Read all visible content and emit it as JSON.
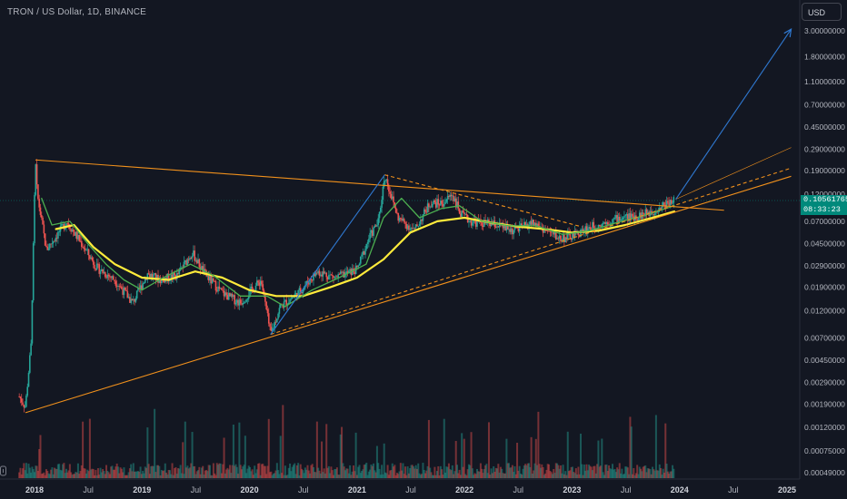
{
  "header": {
    "symbol_line": "TRON / US Dollar, 1D, BINANCE"
  },
  "toolbar": {
    "currency_label": "USD"
  },
  "price_label": {
    "price": "0.10561765",
    "countdown": "08:33:23",
    "color": "#00897b"
  },
  "colors": {
    "background": "#131722",
    "bull_candle": "#26a69a",
    "bear_candle": "#ef5350",
    "ma_yellow": "#ffeb3b",
    "ma_green": "#4caf50",
    "trendline_orange": "#f0901c",
    "arrow_blue": "#2f78d0"
  },
  "icons": {
    "settings": "gear-icon"
  },
  "chart_data": {
    "type": "candlestick",
    "title": "TRON / US Dollar, 1D, BINANCE",
    "yscale": "log",
    "y_ticks": [
      "3.00000000",
      "1.80000000",
      "1.10000000",
      "0.70000000",
      "0.45000000",
      "0.29000000",
      "0.19000000",
      "0.12000000",
      "0.07000000",
      "0.04500000",
      "0.02900000",
      "0.01900000",
      "0.01200000",
      "0.00700000",
      "0.00450000",
      "0.00290000",
      "0.00190000",
      "0.00120000",
      "0.00075000",
      "0.00049000"
    ],
    "x_ticks": [
      "2018",
      "Jul",
      "2019",
      "Jul",
      "2020",
      "Jul",
      "2021",
      "Jul",
      "2022",
      "Jul",
      "2023",
      "Jul",
      "2024",
      "Jul",
      "2025"
    ],
    "price_path": [
      [
        "2017-11-10",
        0.0022
      ],
      [
        "2017-12-01",
        0.0018
      ],
      [
        "2017-12-20",
        0.006
      ],
      [
        "2018-01-04",
        0.23
      ],
      [
        "2018-01-10",
        0.12
      ],
      [
        "2018-02-10",
        0.04
      ],
      [
        "2018-03-10",
        0.05
      ],
      [
        "2018-04-20",
        0.07
      ],
      [
        "2018-06-10",
        0.045
      ],
      [
        "2018-08-01",
        0.028
      ],
      [
        "2018-10-01",
        0.022
      ],
      [
        "2018-12-01",
        0.014
      ],
      [
        "2019-01-20",
        0.025
      ],
      [
        "2019-03-01",
        0.022
      ],
      [
        "2019-05-01",
        0.024
      ],
      [
        "2019-06-20",
        0.038
      ],
      [
        "2019-08-01",
        0.025
      ],
      [
        "2019-10-01",
        0.017
      ],
      [
        "2019-12-01",
        0.014
      ],
      [
        "2020-02-10",
        0.022
      ],
      [
        "2020-03-13",
        0.0075
      ],
      [
        "2020-04-15",
        0.013
      ],
      [
        "2020-06-15",
        0.017
      ],
      [
        "2020-08-20",
        0.026
      ],
      [
        "2020-10-20",
        0.023
      ],
      [
        "2021-01-01",
        0.027
      ],
      [
        "2021-02-10",
        0.05
      ],
      [
        "2021-03-15",
        0.07
      ],
      [
        "2021-04-05",
        0.175
      ],
      [
        "2021-05-20",
        0.075
      ],
      [
        "2021-07-15",
        0.058
      ],
      [
        "2021-09-05",
        0.1
      ],
      [
        "2021-10-20",
        0.1
      ],
      [
        "2021-11-20",
        0.12
      ],
      [
        "2021-12-20",
        0.08
      ],
      [
        "2022-01-20",
        0.07
      ],
      [
        "2022-04-20",
        0.065
      ],
      [
        "2022-06-15",
        0.058
      ],
      [
        "2022-08-20",
        0.068
      ],
      [
        "2022-11-20",
        0.05
      ],
      [
        "2023-01-01",
        0.052
      ],
      [
        "2023-03-10",
        0.063
      ],
      [
        "2023-06-15",
        0.075
      ],
      [
        "2023-08-15",
        0.078
      ],
      [
        "2023-10-15",
        0.088
      ],
      [
        "2023-12-01",
        0.105
      ],
      [
        "2023-12-15",
        0.106
      ]
    ],
    "series": [
      {
        "name": "",
        "color": "#ffeb3b",
        "points": [
          [
            "2018-03-15",
            0.06
          ],
          [
            "2018-05-15",
            0.065
          ],
          [
            "2018-07-20",
            0.042
          ],
          [
            "2018-10-01",
            0.03
          ],
          [
            "2019-01-01",
            0.023
          ],
          [
            "2019-04-01",
            0.022
          ],
          [
            "2019-07-01",
            0.026
          ],
          [
            "2019-10-01",
            0.023
          ],
          [
            "2020-01-01",
            0.018
          ],
          [
            "2020-04-01",
            0.016
          ],
          [
            "2020-07-01",
            0.016
          ],
          [
            "2020-10-01",
            0.019
          ],
          [
            "2021-01-01",
            0.023
          ],
          [
            "2021-04-01",
            0.033
          ],
          [
            "2021-07-01",
            0.056
          ],
          [
            "2021-10-01",
            0.07
          ],
          [
            "2022-01-01",
            0.075
          ],
          [
            "2022-04-01",
            0.068
          ],
          [
            "2022-07-01",
            0.063
          ],
          [
            "2022-10-01",
            0.06
          ],
          [
            "2023-01-01",
            0.056
          ],
          [
            "2023-04-01",
            0.058
          ],
          [
            "2023-07-01",
            0.065
          ],
          [
            "2023-10-01",
            0.075
          ],
          [
            "2023-12-15",
            0.085
          ]
        ]
      },
      {
        "name": "",
        "color": "#4caf50",
        "points": [
          [
            "2018-01-25",
            0.11
          ],
          [
            "2018-03-01",
            0.065
          ],
          [
            "2018-05-01",
            0.07
          ],
          [
            "2018-07-01",
            0.045
          ],
          [
            "2018-09-01",
            0.03
          ],
          [
            "2018-11-01",
            0.022
          ],
          [
            "2019-01-01",
            0.018
          ],
          [
            "2019-03-15",
            0.023
          ],
          [
            "2019-06-15",
            0.03
          ],
          [
            "2019-09-01",
            0.024
          ],
          [
            "2019-12-01",
            0.016
          ],
          [
            "2020-03-01",
            0.016
          ],
          [
            "2020-05-01",
            0.013
          ],
          [
            "2020-08-01",
            0.018
          ],
          [
            "2020-11-01",
            0.023
          ],
          [
            "2021-02-01",
            0.03
          ],
          [
            "2021-04-01",
            0.075
          ],
          [
            "2021-06-01",
            0.11
          ],
          [
            "2021-08-01",
            0.075
          ],
          [
            "2021-10-15",
            0.09
          ],
          [
            "2021-12-15",
            0.095
          ],
          [
            "2022-03-01",
            0.07
          ],
          [
            "2022-06-01",
            0.064
          ],
          [
            "2022-09-01",
            0.064
          ],
          [
            "2022-12-01",
            0.054
          ],
          [
            "2023-03-01",
            0.058
          ],
          [
            "2023-06-01",
            0.068
          ],
          [
            "2023-09-01",
            0.078
          ],
          [
            "2023-12-15",
            0.095
          ]
        ]
      }
    ],
    "drawings": [
      {
        "kind": "line",
        "color": "#f0901c",
        "from": [
          "2018-01-04",
          0.235
        ],
        "to": [
          "2024-06-01",
          0.087
        ]
      },
      {
        "kind": "line",
        "color": "#f0901c",
        "from": [
          "2017-12-01",
          0.0016
        ],
        "to": [
          "2025-01-15",
          0.17
        ]
      },
      {
        "kind": "line",
        "color": "#f0901c",
        "dash": true,
        "from": [
          "2021-04-05",
          0.175
        ],
        "to": [
          "2023-02-01",
          0.063
        ]
      },
      {
        "kind": "line",
        "color": "#f0901c",
        "dash": true,
        "from": [
          "2020-03-13",
          0.0075
        ],
        "to": [
          "2025-01-15",
          0.2
        ]
      },
      {
        "kind": "line",
        "color": "#f0901c",
        "thin": true,
        "from": [
          "2023-12-20",
          0.108
        ],
        "to": [
          "2025-01-15",
          0.3
        ]
      },
      {
        "kind": "line",
        "color": "#2f78d0",
        "from": [
          "2020-03-13",
          0.0075
        ],
        "to": [
          "2021-04-05",
          0.175
        ]
      },
      {
        "kind": "arrow",
        "color": "#2f78d0",
        "from": [
          "2023-12-20",
          0.108
        ],
        "to": [
          "2025-01-15",
          3.1
        ]
      }
    ],
    "grid": false,
    "legend": "none"
  }
}
